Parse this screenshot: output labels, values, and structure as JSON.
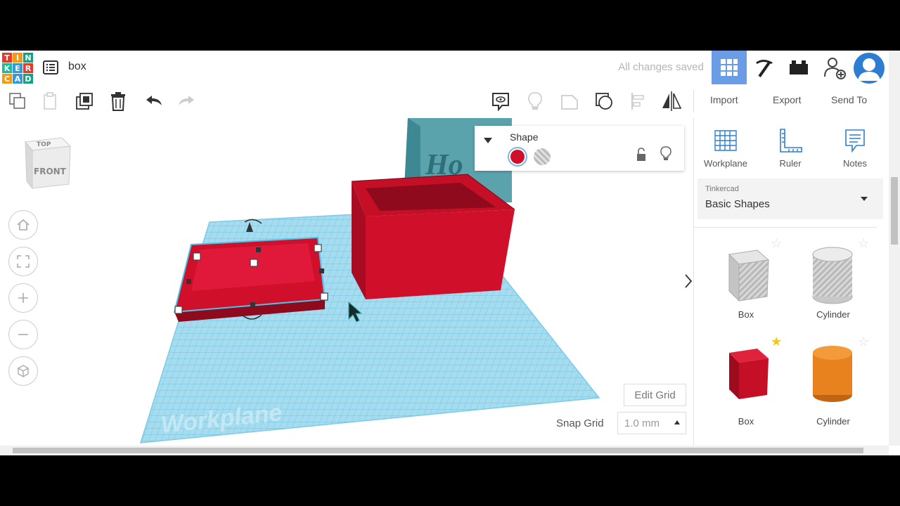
{
  "app": {
    "logo_letters": [
      "T",
      "I",
      "N",
      "K",
      "E",
      "R",
      "C",
      "A",
      "D"
    ],
    "logo_colors": [
      "#e8392b",
      "#f39c12",
      "#16a085",
      "#1abc9c",
      "#3498db",
      "#e8392b",
      "#f39c12",
      "#3498db",
      "#16a085"
    ],
    "document_title": "box",
    "save_status": "All changes saved"
  },
  "toolbar": {
    "import_label": "Import",
    "export_label": "Export",
    "send_to_label": "Send To"
  },
  "workspace": {
    "viewcube_top": "TOP",
    "viewcube_front": "FRONT",
    "workplane_watermark": "Workplane",
    "back_object_text": "Ho",
    "shape_panel": {
      "title": "Shape",
      "solid_color": "#d0102a",
      "hole_color": "#b5b5b5"
    },
    "edit_grid_label": "Edit Grid",
    "snap_grid_label": "Snap Grid",
    "snap_grid_value": "1.0 mm",
    "collapse_icon": "chevron-right-icon"
  },
  "right_panel": {
    "tools": [
      {
        "label": "Workplane",
        "icon": "workplane-icon"
      },
      {
        "label": "Ruler",
        "icon": "ruler-icon"
      },
      {
        "label": "Notes",
        "icon": "notes-icon"
      }
    ],
    "library_source": "Tinkercad",
    "library_value": "Basic Shapes",
    "shapes": [
      {
        "name": "Box",
        "kind": "hole-box",
        "starred": false
      },
      {
        "name": "Cylinder",
        "kind": "hole-cylinder",
        "starred": false
      },
      {
        "name": "Box",
        "kind": "solid-box",
        "starred": true
      },
      {
        "name": "Cylinder",
        "kind": "solid-cylinder",
        "starred": false
      }
    ]
  },
  "colors": {
    "accent_blue": "#6b9de6",
    "workplane_blue": "#8fd3eb",
    "box_red": "#d0102a",
    "cylinder_orange": "#e8821e",
    "teal_object": "#5aa3ad"
  }
}
